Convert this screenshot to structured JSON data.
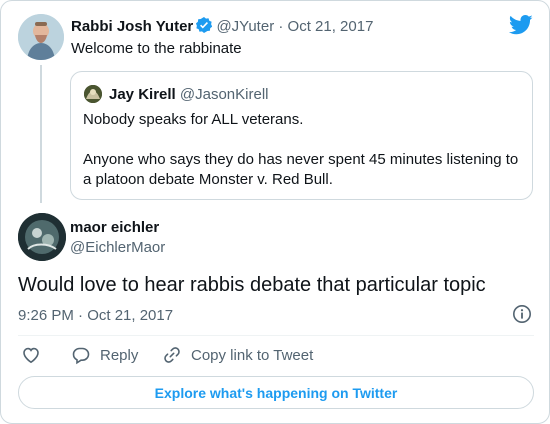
{
  "parent_tweet": {
    "name": "Rabbi Josh Yuter",
    "handle": "@JYuter",
    "date": "· Oct 21, 2017",
    "text": "Welcome to the rabbinate"
  },
  "quoted_tweet": {
    "name": "Jay Kirell",
    "handle": "@JasonKirell",
    "text_line1": "Nobody speaks for ALL veterans.",
    "text_line2": "Anyone who says they do has never spent 45 minutes listening to a platoon debate Monster v. Red Bull."
  },
  "main_tweet": {
    "name": "maor eichler",
    "handle": "@EichlerMaor",
    "text": "Would love to hear rabbis debate that particular topic",
    "timestamp": "9:26 PM · Oct 21, 2017"
  },
  "actions": {
    "reply_label": "Reply",
    "copy_label": "Copy link to Tweet"
  },
  "explore_label": "Explore what's happening on Twitter",
  "colors": {
    "brand": "#1d9bf0",
    "text": "#0f1419",
    "muted": "#536471",
    "border": "#cfd9de"
  },
  "icons": [
    "twitter-bird-icon",
    "verified-badge-icon",
    "info-icon",
    "heart-icon",
    "reply-icon",
    "link-icon"
  ]
}
